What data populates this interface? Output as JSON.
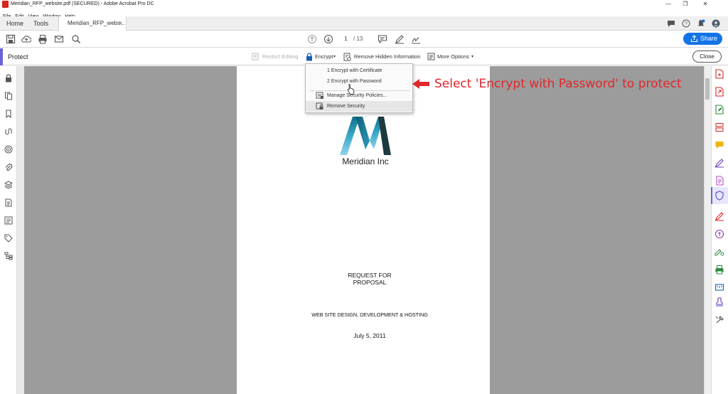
{
  "window": {
    "title": "Meridian_RFP_website.pdf (SECURED) - Adobe Acrobat Pro DC"
  },
  "menu": [
    "File",
    "Edit",
    "View",
    "Window",
    "Help"
  ],
  "tabs": {
    "home": "Home",
    "tools": "Tools",
    "document": "Meridian_RFP_webs...",
    "close_symbol": "×"
  },
  "toolbar": {
    "page_current": "1",
    "page_total": "/ 13",
    "share_label": "Share"
  },
  "protect_bar": {
    "title": "Protect",
    "restrict_editing": "Restrict Editing",
    "encrypt": "Encrypt",
    "remove_hidden": "Remove Hidden Information",
    "more_options": "More Options",
    "close": "Close"
  },
  "encrypt_menu": {
    "items": [
      "1 Encrypt with Certificate",
      "2 Encrypt with Password",
      "Manage Security Policies...",
      "Remove Security"
    ]
  },
  "annotation": {
    "text": "Select 'Encrypt with Password' to protect",
    "color": "#e0272a"
  },
  "document": {
    "company": "Meridian Inc",
    "title_line1": "REQUEST FOR",
    "title_line2": "PROPOSAL",
    "subtitle": "WEB SITE DESIGN, DEVELOPMENT & HOSTING",
    "date": "July 5, 2011"
  },
  "colors": {
    "accent": "#6a63d6",
    "share": "#1473e6",
    "acrobat_red": "#d9261c"
  }
}
